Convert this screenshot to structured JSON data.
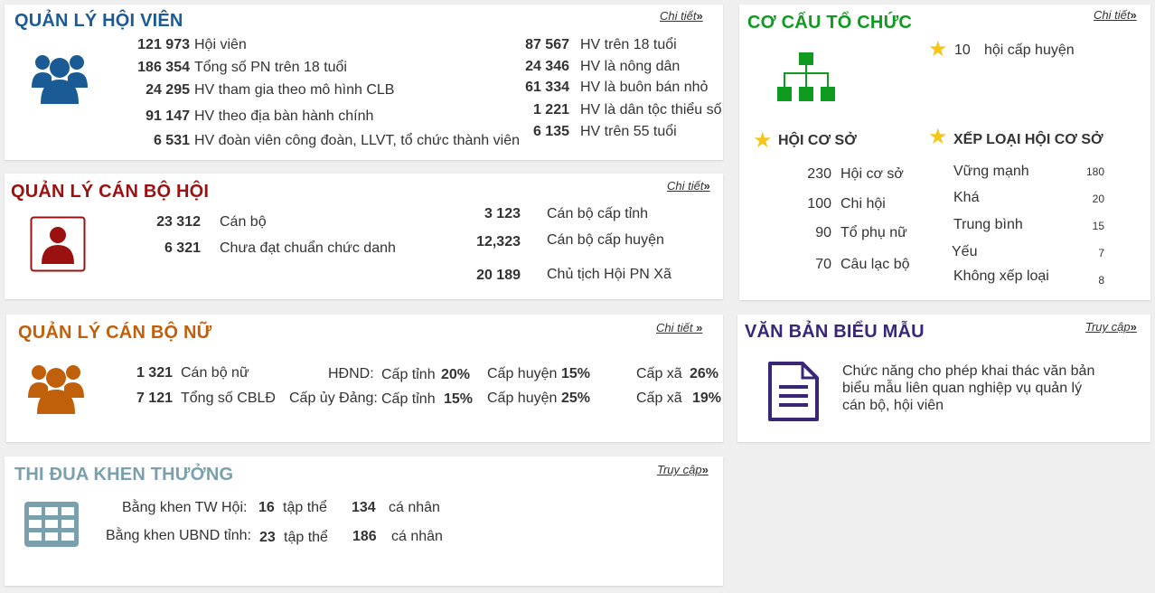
{
  "members": {
    "title": "QUẢN LÝ HỘI VIÊN",
    "more": "Chi tiết",
    "left": [
      {
        "num": "121 973",
        "label": "Hội viên"
      },
      {
        "num": "186 354",
        "label": "Tổng số PN trên 18 tuổi"
      },
      {
        "num": "24 295",
        "label": "HV tham gia theo mô hình CLB"
      },
      {
        "num": "91 147",
        "label": "HV theo địa bàn hành chính"
      },
      {
        "num": "6 531",
        "label": "HV đoàn viên công đoàn, LLVT, tổ chức thành viên"
      }
    ],
    "right": [
      {
        "num": "87 567",
        "label": "HV trên 18 tuổi"
      },
      {
        "num": "24 346",
        "label": "HV là nông dân"
      },
      {
        "num": "61 334",
        "label": "HV là buôn bán nhỏ"
      },
      {
        "num": "1 221",
        "label": "HV là dân tộc thiểu số"
      },
      {
        "num": "6 135",
        "label": "HV trên 55 tuổi"
      }
    ]
  },
  "staff": {
    "title": "QUẢN LÝ CÁN BỘ HỘI",
    "more": "Chi tiết",
    "left": [
      {
        "num": "23 312",
        "label": "Cán bộ"
      },
      {
        "num": "6 321",
        "label": "Chưa đạt chuẩn chức danh"
      }
    ],
    "right": [
      {
        "num": "3 123",
        "label": "Cán bộ cấp tỉnh"
      },
      {
        "num": "12,323",
        "label": "Cán bộ cấp huyện"
      },
      {
        "num": "20 189",
        "label": "Chủ tịch Hội PN Xã"
      }
    ]
  },
  "women": {
    "title": "QUẢN LÝ CÁN BỘ NỮ",
    "more": "Chi tiết",
    "row1": {
      "num": "1 321",
      "label": "Cán bộ nữ",
      "group": "HĐND:",
      "l1": "Cấp tỉnh",
      "v1": "20%",
      "l2": "Cấp huyện",
      "v2": "15%",
      "l3": "Cấp xã",
      "v3": "26%"
    },
    "row2": {
      "num": "7 121",
      "label": "Tổng số CBLĐ",
      "group": "Cấp ủy Đảng:",
      "l1": "Cấp tỉnh",
      "v1": "15%",
      "l2": "Cấp huyện",
      "v2": "25%",
      "l3": "Cấp xã",
      "v3": "19%"
    }
  },
  "awards": {
    "title": "THI ĐUA KHEN THƯỞNG",
    "more": "Truy cập",
    "rows": [
      {
        "label": "Bằng khen TW Hội:",
        "n1": "16",
        "u1": "tập thể",
        "n2": "134",
        "u2": "cá nhân"
      },
      {
        "label": "Bằng khen UBND tỉnh:",
        "n1": "23",
        "u1": "tập thể",
        "n2": "186",
        "u2": "cá nhân"
      }
    ]
  },
  "org": {
    "title": "CƠ CẤU TỔ CHỨC",
    "more": "Chi tiết",
    "district": {
      "num": "10",
      "label": "hội cấp huyện"
    },
    "base_title": "HỘI CƠ SỞ",
    "base": [
      {
        "num": "230",
        "label": "Hội cơ sở"
      },
      {
        "num": "100",
        "label": "Chi hội"
      },
      {
        "num": "90",
        "label": "Tổ phụ nữ"
      },
      {
        "num": "70",
        "label": "Câu lạc bộ"
      }
    ],
    "rank_title": "XẾP LOẠI HỘI CƠ SỞ",
    "ranks": [
      {
        "label": "Vững mạnh",
        "num": "180"
      },
      {
        "label": "Khá",
        "num": "20"
      },
      {
        "label": "Trung bình",
        "num": "15"
      },
      {
        "label": "Yếu",
        "num": "7"
      },
      {
        "label": "Không xếp loại",
        "num": "8"
      }
    ]
  },
  "docs": {
    "title": "VĂN BẢN BIỂU MẪU",
    "more": "Truy cập",
    "lines": [
      "Chức năng cho phép khai thác văn bản",
      "biểu mẫu liên quan nghiệp vụ quản lý",
      "cán bộ, hội viên"
    ]
  },
  "colors": {
    "members": "#1b5b95",
    "staff": "#9b1010",
    "women": "#c0600b",
    "awards": "#7aa0ad",
    "org": "#0f9a20",
    "docs": "#3a2676"
  }
}
